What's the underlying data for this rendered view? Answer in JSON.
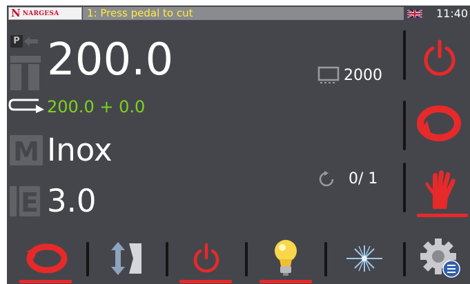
{
  "header": {
    "logo_text": "NARGESA",
    "logo_letter": "N",
    "message": "1: Press pedal to cut",
    "clock": "11:40",
    "language_flag": "uk-flag-icon"
  },
  "main": {
    "mode_letter": "P",
    "length": "200.0",
    "cut_formula": "200.0 + 0.0",
    "material": "Inox",
    "thickness": "3.0",
    "stock": "2000",
    "count": "0/ 1"
  },
  "right_panel": {
    "buttons": [
      "power-button",
      "cycle-button",
      "manual-hand-button"
    ],
    "active": "manual-hand-button"
  },
  "bottom_bar": {
    "buttons": [
      "cycle-mode-button",
      "blade-vertical-button",
      "power-off-button",
      "light-button",
      "laser-button",
      "settings-menu-button"
    ],
    "active": [
      "cycle-mode-button",
      "power-off-button",
      "light-button"
    ]
  },
  "colors": {
    "background": "#45464b",
    "accent_red": "#e8292a",
    "value_green": "#7cd321",
    "message_yellow": "#ffeb3b"
  }
}
